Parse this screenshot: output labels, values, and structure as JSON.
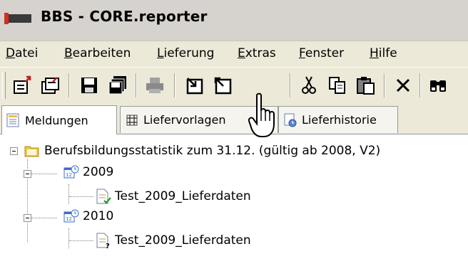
{
  "window": {
    "title": "BBS - CORE.reporter"
  },
  "menu": {
    "items": [
      {
        "first": "D",
        "rest": "atei"
      },
      {
        "first": "B",
        "rest": "earbeiten"
      },
      {
        "first": "L",
        "rest": "ieferung"
      },
      {
        "first": "E",
        "rest": "xtras"
      },
      {
        "first": "F",
        "rest": "enster"
      },
      {
        "first": "H",
        "rest": "ilfe"
      }
    ]
  },
  "toolbar": {
    "buttons": [
      "new-icon",
      "open-icon",
      "save-icon",
      "save-all-icon",
      "print-icon",
      "import-icon",
      "export-icon",
      "cut-icon",
      "copy-icon",
      "paste-icon",
      "delete-icon",
      "find-icon"
    ]
  },
  "tabs": [
    {
      "label": "Meldungen",
      "active": true
    },
    {
      "label": "Liefervorlagen",
      "active": false
    },
    {
      "label": "Lieferhistorie",
      "active": false
    }
  ],
  "tree": {
    "root": "Berufsbildungsstatistik zum 31.12. (gültig ab 2008, V2)",
    "years": [
      {
        "label": "2009",
        "file": "Test_2009_Lieferdaten",
        "status": "checked"
      },
      {
        "label": "2010",
        "file": "Test_2009_Lieferdaten",
        "status": "unknown"
      }
    ]
  },
  "colors": {
    "titlebar": "#d6d3ce",
    "menubar": "#ece9d8",
    "folder": "#f0c648",
    "calendar": "#3a6ec8"
  }
}
